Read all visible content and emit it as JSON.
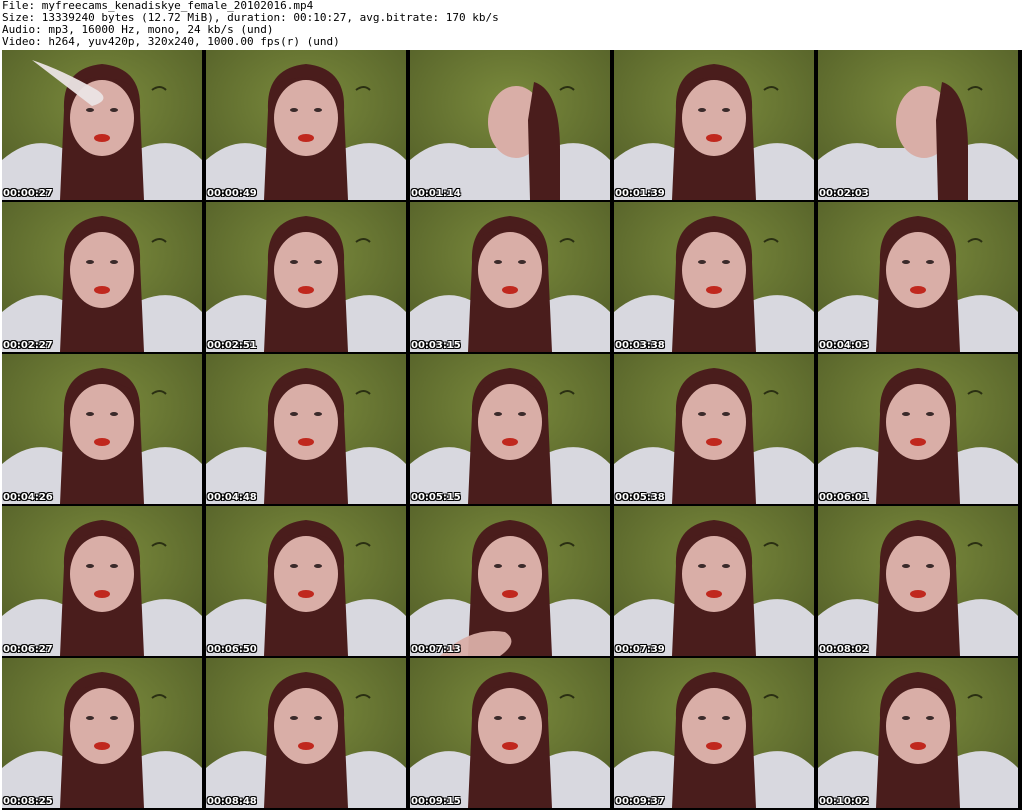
{
  "header": {
    "file_line": "File: myfreecams_kenadiskye_female_20102016.mp4",
    "size_line": "Size: 13339240 bytes (12.72 MiB), duration: 00:10:27, avg.bitrate: 170 kb/s",
    "audio_line": "Audio: mp3, 16000 Hz, mono, 24 kb/s (und)",
    "video_line": "Video: h264, yuv420p, 320x240, 1000.00 fps(r) (und)"
  },
  "thumbnails": [
    {
      "timestamp": "00:00:27",
      "pose": "hand"
    },
    {
      "timestamp": "00:00:49",
      "pose": "front"
    },
    {
      "timestamp": "00:01:14",
      "pose": "turn-left"
    },
    {
      "timestamp": "00:01:39",
      "pose": "front"
    },
    {
      "timestamp": "00:02:03",
      "pose": "turn-left"
    },
    {
      "timestamp": "00:02:27",
      "pose": "front"
    },
    {
      "timestamp": "00:02:51",
      "pose": "front"
    },
    {
      "timestamp": "00:03:15",
      "pose": "front"
    },
    {
      "timestamp": "00:03:38",
      "pose": "front"
    },
    {
      "timestamp": "00:04:03",
      "pose": "front"
    },
    {
      "timestamp": "00:04:26",
      "pose": "front"
    },
    {
      "timestamp": "00:04:48",
      "pose": "front"
    },
    {
      "timestamp": "00:05:15",
      "pose": "front"
    },
    {
      "timestamp": "00:05:38",
      "pose": "front"
    },
    {
      "timestamp": "00:06:01",
      "pose": "front"
    },
    {
      "timestamp": "00:06:27",
      "pose": "front"
    },
    {
      "timestamp": "00:06:50",
      "pose": "front"
    },
    {
      "timestamp": "00:07:13",
      "pose": "hand"
    },
    {
      "timestamp": "00:07:39",
      "pose": "front"
    },
    {
      "timestamp": "00:08:02",
      "pose": "front"
    },
    {
      "timestamp": "00:08:25",
      "pose": "front"
    },
    {
      "timestamp": "00:08:48",
      "pose": "front"
    },
    {
      "timestamp": "00:09:15",
      "pose": "front"
    },
    {
      "timestamp": "00:09:37",
      "pose": "front"
    },
    {
      "timestamp": "00:10:02",
      "pose": "front"
    }
  ],
  "colors": {
    "wall": "#4f5a26",
    "wall_light": "#7a8a3c",
    "hair": "#4a1d1c",
    "skin": "#d9aea7",
    "shirt": "#d8d8df",
    "lips": "#c0281e"
  }
}
